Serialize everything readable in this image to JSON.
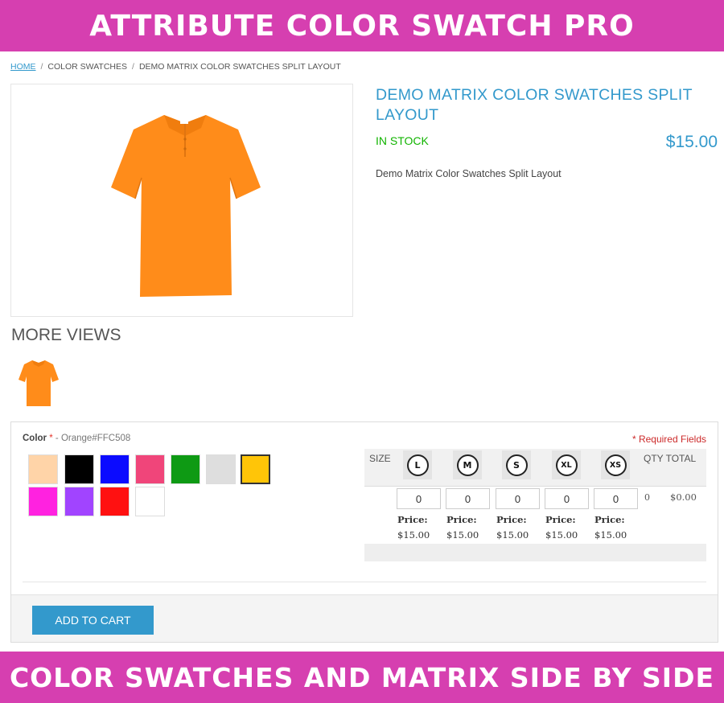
{
  "banner_top": "ATTRIBUTE COLOR SWATCH PRO",
  "banner_bottom": "COLOR SWATCHES AND MATRIX SIDE BY SIDE",
  "breadcrumb": {
    "home": "HOME",
    "separator": "/",
    "category": "COLOR SWATCHES",
    "current": "DEMO MATRIX COLOR SWATCHES SPLIT LAYOUT"
  },
  "product": {
    "title": "DEMO MATRIX COLOR SWATCHES SPLIT LAYOUT",
    "stock": "IN STOCK",
    "price": "$15.00",
    "short_description": "Demo Matrix Color Swatches Split Layout",
    "image_icon": "orange-polo-shirt-image",
    "shirt_color": "#ff8c1a"
  },
  "more_views": {
    "heading": "MORE VIEWS",
    "thumb_icon": "orange-polo-shirt-thumbnail"
  },
  "color_option": {
    "label": "Color",
    "required_mark": "*",
    "dash": "-",
    "selected_value": "Orange#FFC508",
    "required_note": "* Required Fields",
    "swatches": [
      {
        "color": "#ffd4a8"
      },
      {
        "color": "#000000"
      },
      {
        "color": "#0b0bff"
      },
      {
        "color": "#f0457a"
      },
      {
        "color": "#0e9a14"
      },
      {
        "color": "#dedede"
      },
      {
        "color": "#ffc508",
        "selected": true
      },
      {
        "color": "#ff22e0"
      },
      {
        "color": "#a144ff"
      },
      {
        "color": "#ff1111"
      },
      {
        "color": "#ffffff"
      }
    ]
  },
  "matrix": {
    "size_header": "SIZE",
    "qty_header": "QTY",
    "total_header": "TOTAL",
    "sizes": [
      "L",
      "M",
      "S",
      "XL",
      "XS"
    ],
    "qty_values": [
      "0",
      "0",
      "0",
      "0",
      "0"
    ],
    "price_label": "Price:",
    "price_value": "$15.00",
    "row_qty": "0",
    "row_total": "$0.00"
  },
  "add_to_cart_label": "ADD TO CART"
}
